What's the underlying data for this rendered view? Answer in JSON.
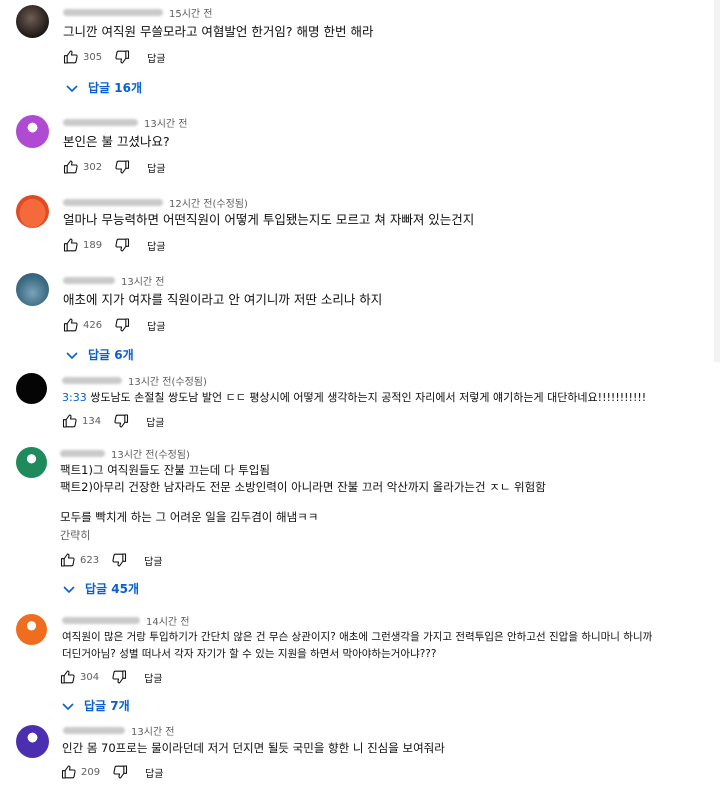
{
  "comments": [
    {
      "time": "15시간 전",
      "text": "그니깐 여직원 무쓸모라고 여혐발언 한거임? 해명 한번 해라",
      "likes": "305",
      "replies": "답글 16개"
    },
    {
      "time": "13시간 전",
      "text": "본인은 불 끄셨나요?",
      "likes": "302"
    },
    {
      "time": "12시간 전(수정됨)",
      "text": "얼마나 무능력하면 어떤직원이 어떻게 투입됐는지도 모르고 쳐 자빠져 있는건지",
      "likes": "189"
    },
    {
      "time": "13시간 전",
      "text": "애초에 지가 여자를 직원이라고 안 여기니까 저딴 소리나 하지",
      "likes": "426",
      "replies": "답글 6개"
    },
    {
      "time": "13시간 전(수정됨)",
      "timestamp": "3:33",
      "text": " 쌍도남도 손절칠 쌍도남 발언 ㄷㄷ 평상시에 어떻게 생각하는지 공적인 자리에서 저렇게 얘기하는게 대단하네요!!!!!!!!!!!",
      "likes": "134"
    },
    {
      "time": "13시간 전(수정됨)",
      "lines": [
        "팩트1)그 여직원들도 잔불 끄는데 다 투입됨",
        "팩트2)아무리 건장한 남자라도 전문 소방인력이 아니라면 잔불 끄러 악산까지 올라가는건 ㅈㄴ 위험함",
        "",
        "모두를 빡치게 하는 그 어려운 일을 김두겸이 해냄ㅋㅋ"
      ],
      "brief": "간략히",
      "likes": "623",
      "replies": "답글 45개"
    },
    {
      "time": "14시간 전",
      "lines": [
        "여직원이 많은 거랑 투입하기가 간단치 않은 건 무슨 상관이지? 애초에 그런생각을 가지고 전력투입은 안하고선 진압을 하니마니 하니까",
        "더딘거아님? 성별 떠나서 각자 자기가 할 수 있는 지원을 하면서 막아야하는거아냐???"
      ],
      "likes": "304",
      "replies": "답글 7개"
    },
    {
      "time": "13시간 전",
      "text": "인간 몸 70프로는 물이라던데 저거 던지면 될듯 국민을 향한 니 진심을 보여줘라",
      "likes": "209"
    }
  ],
  "reply_label": "답글",
  "icons": {
    "like": "thumbs-up-icon",
    "dislike": "thumbs-down-icon",
    "expand": "chevron-down-icon"
  },
  "colors": {
    "link": "#065fd4",
    "meta": "#606060"
  }
}
